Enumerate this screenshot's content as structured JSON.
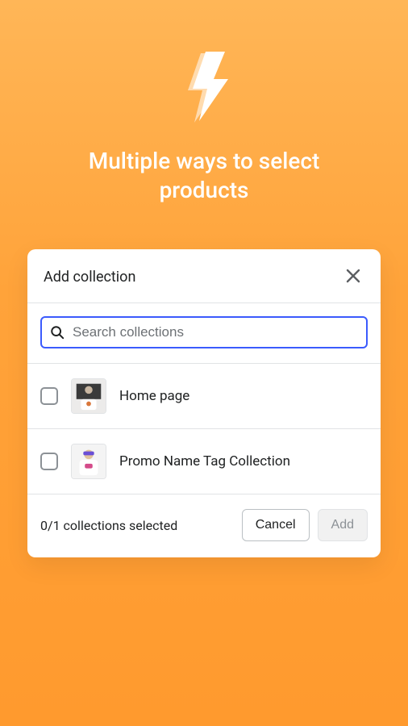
{
  "hero": {
    "title": "Multiple ways to select products"
  },
  "modal": {
    "title": "Add collection",
    "search": {
      "placeholder": "Search collections",
      "value": ""
    },
    "items": [
      {
        "label": "Home page"
      },
      {
        "label": "Promo Name Tag Collection"
      }
    ],
    "footer": {
      "status": "0/1 collections selected",
      "cancel": "Cancel",
      "add": "Add"
    }
  }
}
